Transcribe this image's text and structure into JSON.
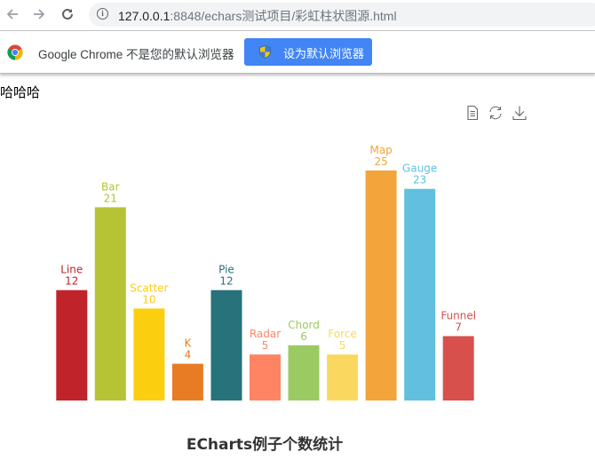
{
  "browser": {
    "nav": {
      "back_icon": "arrow-left-icon",
      "forward_icon": "arrow-right-icon",
      "reload_icon": "reload-icon"
    },
    "url_host": "127.0.0.1",
    "url_rest": ":8848/echars测试项目/彩虹柱状图源.html",
    "infobar_text": "Google Chrome 不是您的默认浏览器",
    "set_default_label": "设为默认浏览器"
  },
  "page": {
    "heading": "哈哈哈"
  },
  "toolbox": {
    "items": [
      {
        "name": "data-view",
        "icon": "data-view-icon"
      },
      {
        "name": "restore",
        "icon": "restore-icon"
      },
      {
        "name": "save-as-image",
        "icon": "download-icon"
      }
    ]
  },
  "chart_data": {
    "type": "bar",
    "title": "ECharts例子个数统计",
    "categories": [
      "Line",
      "Bar",
      "Scatter",
      "K",
      "Pie",
      "Radar",
      "Chord",
      "Force",
      "Map",
      "Gauge",
      "Funnel"
    ],
    "values": [
      12,
      21,
      10,
      4,
      12,
      5,
      6,
      5,
      25,
      23,
      7
    ],
    "colors": [
      "#C1232B",
      "#B5C334",
      "#FCCE10",
      "#E87C25",
      "#27727B",
      "#FE8463",
      "#9BCA63",
      "#FAD860",
      "#F3A43B",
      "#60C0DD",
      "#D7504B"
    ],
    "xlabel": "",
    "ylabel": "",
    "ylim": [
      0,
      25
    ],
    "grid": false,
    "axes_visible": false,
    "legend": "none",
    "label_format": "{name}\n{value}"
  }
}
